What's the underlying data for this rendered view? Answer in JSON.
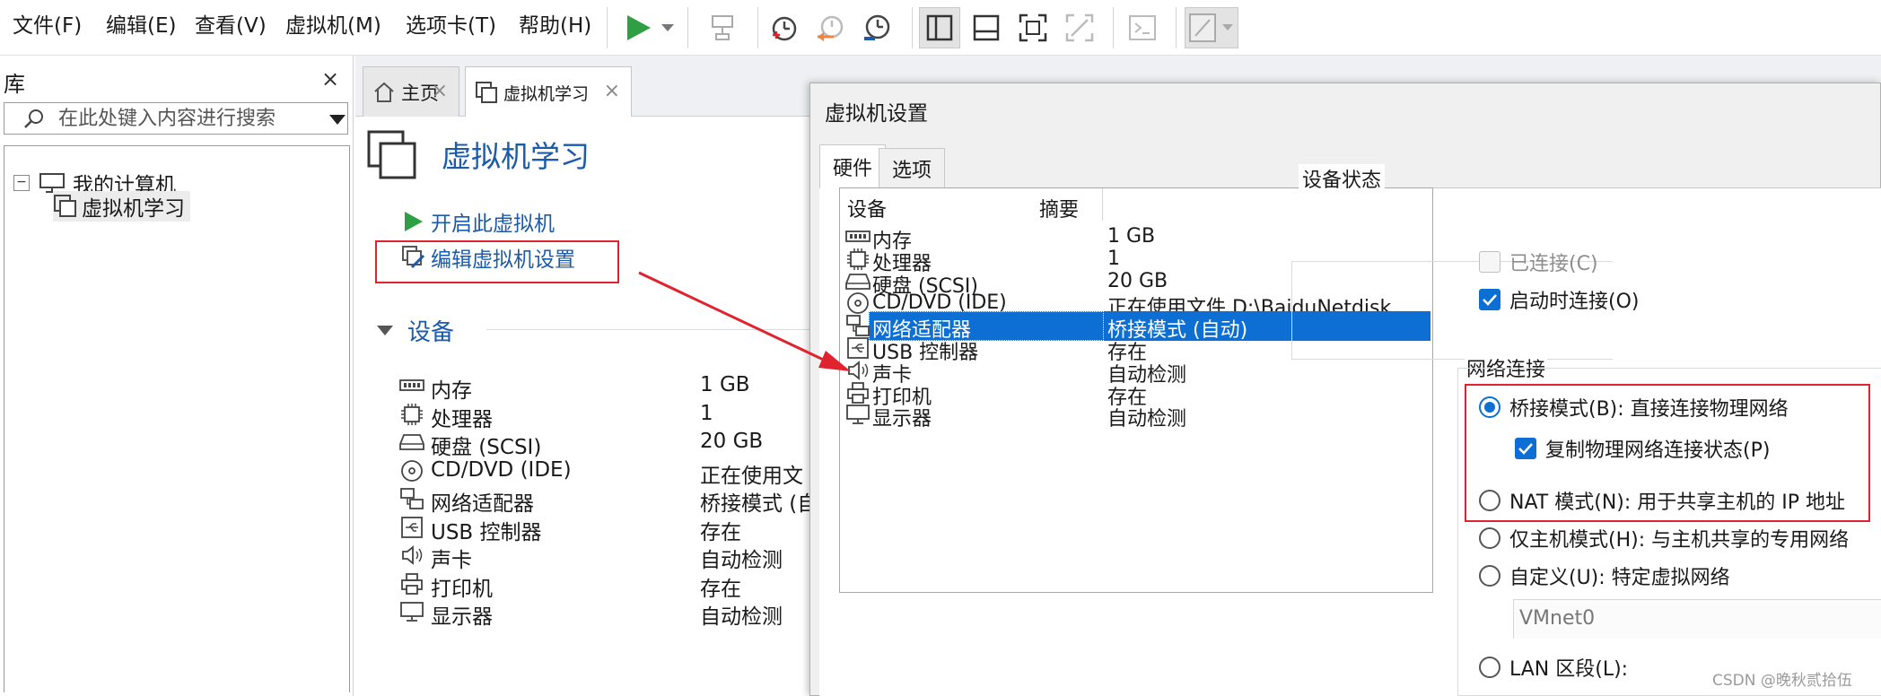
{
  "menu": [
    "文件(F)",
    "编辑(E)",
    "查看(V)",
    "虚拟机(M)",
    "选项卡(T)",
    "帮助(H)"
  ],
  "library": {
    "title": "库",
    "close": "×",
    "search_placeholder": "在此处键入内容进行搜索",
    "tree": [
      {
        "label": "我的计算机",
        "toggle": "−"
      },
      {
        "label": "虚拟机学习"
      }
    ]
  },
  "tabs": [
    {
      "label": "主页",
      "close": "×"
    },
    {
      "label": "虚拟机学习",
      "close": "×"
    }
  ],
  "vm": {
    "title": "虚拟机学习",
    "actions": [
      "开启此虚拟机",
      "编辑虚拟机设置"
    ],
    "devices_heading": "设备",
    "devices": [
      {
        "icon": "memory-icon",
        "name": "内存",
        "value": "1 GB"
      },
      {
        "icon": "processor-icon",
        "name": "处理器",
        "value": "1"
      },
      {
        "icon": "hard-disk-icon",
        "name": "硬盘 (SCSI)",
        "value": "20 GB"
      },
      {
        "icon": "cd-dvd-icon",
        "name": "CD/DVD (IDE)",
        "value": "正在使用文"
      },
      {
        "icon": "network-adapter-icon",
        "name": "网络适配器",
        "value": "桥接模式 (自"
      },
      {
        "icon": "usb-icon",
        "name": "USB 控制器",
        "value": "存在"
      },
      {
        "icon": "sound-card-icon",
        "name": "声卡",
        "value": "自动检测"
      },
      {
        "icon": "printer-icon",
        "name": "打印机",
        "value": "存在"
      },
      {
        "icon": "display-icon",
        "name": "显示器",
        "value": "自动检测"
      }
    ]
  },
  "dialog": {
    "title": "虚拟机设置",
    "tabs": [
      "硬件",
      "选项"
    ],
    "list_headers": {
      "device": "设备",
      "summary": "摘要"
    },
    "hardware": [
      {
        "icon": "memory-icon",
        "name": "内存",
        "value": "1 GB"
      },
      {
        "icon": "processor-icon",
        "name": "处理器",
        "value": "1"
      },
      {
        "icon": "hard-disk-icon",
        "name": "硬盘 (SCSI)",
        "value": "20 GB"
      },
      {
        "icon": "cd-dvd-icon",
        "name": "CD/DVD (IDE)",
        "value": "正在使用文件 D:\\BaiduNetdisk..."
      },
      {
        "icon": "network-adapter-icon",
        "name": "网络适配器",
        "value": "桥接模式 (自动)",
        "selected": true
      },
      {
        "icon": "usb-icon",
        "name": "USB 控制器",
        "value": "存在"
      },
      {
        "icon": "sound-card-icon",
        "name": "声卡",
        "value": "自动检测"
      },
      {
        "icon": "printer-icon",
        "name": "打印机",
        "value": "存在"
      },
      {
        "icon": "display-icon",
        "name": "显示器",
        "value": "自动检测"
      }
    ],
    "device_status": {
      "title": "设备状态",
      "connected": "已连接(C)",
      "connect_at_power_on": "启动时连接(O)"
    },
    "network": {
      "title": "网络连接",
      "bridged": "桥接模式(B): 直接连接物理网络",
      "replicate": "复制物理网络连接状态(P)",
      "nat": "NAT 模式(N): 用于共享主机的 IP 地址",
      "host_only": "仅主机模式(H): 与主机共享的专用网络",
      "custom": "自定义(U): 特定虚拟网络",
      "custom_value": "VMnet0",
      "lan": "LAN 区段(L):"
    }
  },
  "watermark": "CSDN @晚秋贰拾伍",
  "colors": {
    "accent": "#1d5ba8",
    "selection": "#0d6fd4",
    "highlight": "#e0242f",
    "play": "#2ea043"
  }
}
